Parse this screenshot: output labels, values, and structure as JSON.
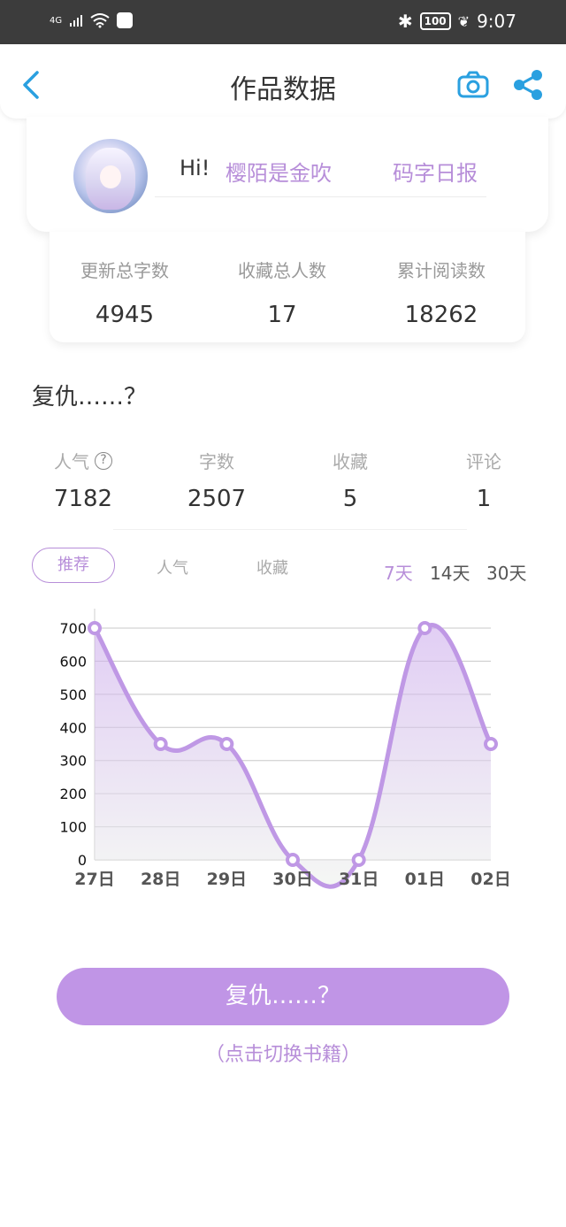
{
  "status_bar": {
    "network": "4G",
    "carrier_badge": "HUAWEI",
    "battery": "100",
    "time": "9:07"
  },
  "nav": {
    "title": "作品数据"
  },
  "user": {
    "greeting": "Hi!",
    "name": "樱陌是金吹",
    "daily_report": "码字日报"
  },
  "stats": [
    {
      "label": "更新总字数",
      "value": "4945"
    },
    {
      "label": "收藏总人数",
      "value": "17"
    },
    {
      "label": "累计阅读数",
      "value": "18262"
    }
  ],
  "book": {
    "title": "复仇……？",
    "metrics": [
      {
        "label": "人气",
        "value": "7182"
      },
      {
        "label": "字数",
        "value": "2507"
      },
      {
        "label": "收藏",
        "value": "5"
      },
      {
        "label": "评论",
        "value": "1"
      }
    ]
  },
  "tabs": {
    "recommend": "推荐",
    "popularity": "人气",
    "favorites": "收藏"
  },
  "ranges": [
    "7天",
    "14天",
    "30天"
  ],
  "active_range": "7天",
  "colors": {
    "accent": "#b78ed9",
    "button": "#c095e6",
    "line": "#bf98e5"
  },
  "chart_data": {
    "type": "area",
    "categories": [
      "27日",
      "28日",
      "29日",
      "30日",
      "31日",
      "01日",
      "02日"
    ],
    "series": [
      {
        "values": [
          700,
          350,
          350,
          0,
          0,
          700,
          350
        ]
      }
    ],
    "y_ticks": [
      "0",
      "100",
      "200",
      "300",
      "400",
      "500",
      "600",
      "700"
    ],
    "ylim": [
      0,
      700
    ],
    "grid": true,
    "smooth": true
  },
  "footer": {
    "button_label": "复仇……？",
    "hint": "（点击切换书籍）"
  }
}
